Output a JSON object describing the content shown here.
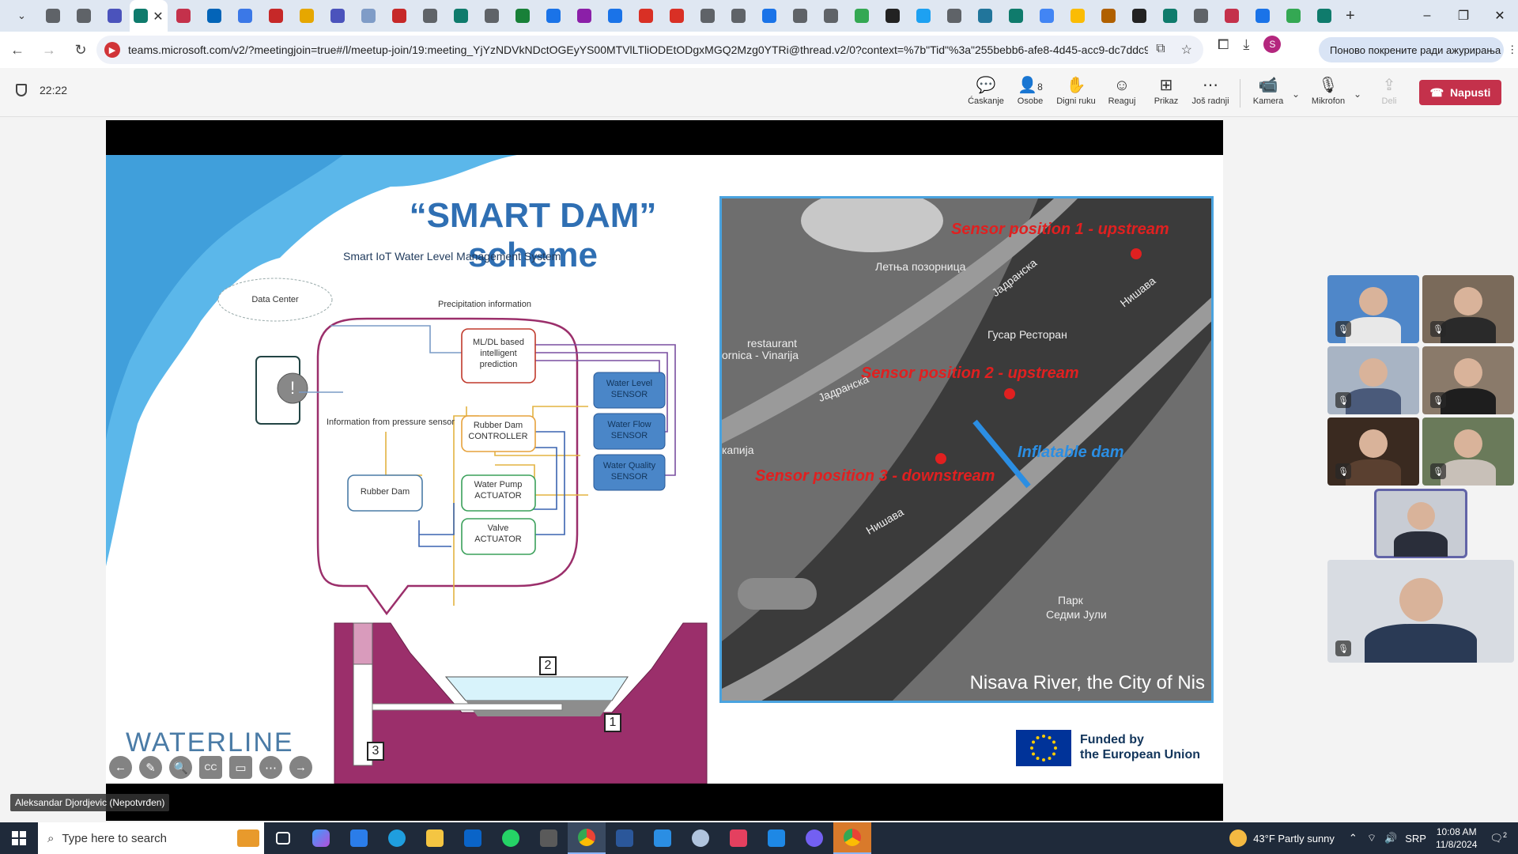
{
  "browser": {
    "tabs": [
      {
        "icon": "chrome-icon",
        "color": "#5f6368"
      },
      {
        "icon": "home-icon",
        "color": "#5f6368"
      },
      {
        "icon": "teams-icon",
        "color": "#4b53bc"
      },
      {
        "icon": "sway-icon",
        "color": "#0f7b6c"
      },
      {
        "icon": "pin-icon",
        "color": "#c4314b"
      },
      {
        "icon": "onedrive-icon",
        "color": "#0364b8"
      },
      {
        "icon": "globe-icon",
        "color": "#3b78e7"
      },
      {
        "icon": "pdf-icon",
        "color": "#c62828"
      },
      {
        "icon": "c-icon",
        "color": "#e6a700"
      },
      {
        "icon": "globe-icon",
        "color": "#4b53bc"
      },
      {
        "icon": "image-icon",
        "color": "#7f9cc7"
      },
      {
        "icon": "pdf-icon",
        "color": "#c62828"
      },
      {
        "icon": "link-icon",
        "color": "#5f6368"
      },
      {
        "icon": "sway-icon",
        "color": "#0f7b6c"
      },
      {
        "icon": "link-icon",
        "color": "#5f6368"
      },
      {
        "icon": "globe-icon",
        "color": "#188038"
      },
      {
        "icon": "globe-icon",
        "color": "#1a73e8"
      },
      {
        "icon": "mail-icon",
        "color": "#8b1fa8"
      },
      {
        "icon": "globe-icon",
        "color": "#1a73e8"
      },
      {
        "icon": "gmail-icon",
        "color": "#d93025"
      },
      {
        "icon": "gmail-icon",
        "color": "#d93025"
      },
      {
        "icon": "link-icon",
        "color": "#5f6368"
      },
      {
        "icon": "link-icon",
        "color": "#5f6368"
      },
      {
        "icon": "translate-icon",
        "color": "#1a73e8"
      },
      {
        "icon": "link-icon",
        "color": "#5f6368"
      },
      {
        "icon": "link-icon",
        "color": "#5f6368"
      },
      {
        "icon": "maps-icon",
        "color": "#34a853"
      },
      {
        "icon": "info-icon",
        "color": "#222222"
      },
      {
        "icon": "twitter-icon",
        "color": "#1da1f2"
      },
      {
        "icon": "globe-icon",
        "color": "#5f6368"
      },
      {
        "icon": "wordpress-icon",
        "color": "#21759b"
      },
      {
        "icon": "globe-icon",
        "color": "#0f7b6c"
      },
      {
        "icon": "google-icon",
        "color": "#4285f4"
      },
      {
        "icon": "drive-icon",
        "color": "#fbbc04"
      },
      {
        "icon": "globe-icon",
        "color": "#b06000"
      },
      {
        "icon": "info-icon",
        "color": "#222222"
      },
      {
        "icon": "sway-icon",
        "color": "#0f7b6c"
      },
      {
        "icon": "link-icon",
        "color": "#5f6368"
      },
      {
        "icon": "globe-icon",
        "color": "#c4314b"
      },
      {
        "icon": "globe-icon",
        "color": "#1a73e8"
      },
      {
        "icon": "sheets-icon",
        "color": "#34a853"
      },
      {
        "icon": "sway-icon",
        "color": "#0f7b6c"
      }
    ],
    "active_tab_close": "✕",
    "new_tab": "+",
    "url": "teams.microsoft.com/v2/?meetingjoin=true#/l/meetup-join/19:meeting_YjYzNDVkNDctOGEyYS00MTVlLTliODEtODgxMGQ2Mzg0YTRi@thread.v2/0?context=%7b\"Tid\"%3a\"255bebb6-afe8-4d45-acc9-dc7ddc94...",
    "profile_initial": "S",
    "update_label": "Поново покрените ради ажурирања",
    "window_controls": {
      "minimize": "–",
      "restore": "❐",
      "close": "✕"
    }
  },
  "teams": {
    "meeting_timer": "22:22",
    "toolbar": {
      "chat": {
        "label": "Ćaskanje",
        "icon": "chat-icon"
      },
      "people": {
        "label": "Osobe",
        "count": "8",
        "icon": "people-icon"
      },
      "raise_hand": {
        "label": "Digni ruku",
        "icon": "hand-icon"
      },
      "react": {
        "label": "Reaguj",
        "icon": "smiley-icon"
      },
      "view": {
        "label": "Prikaz",
        "icon": "grid-icon"
      },
      "more": {
        "label": "Još radnji",
        "icon": "more-icon"
      },
      "camera": {
        "label": "Kamera",
        "icon": "camera-icon"
      },
      "mic": {
        "label": "Mikrofon",
        "icon": "mic-off-icon"
      },
      "share": {
        "label": "Deli",
        "icon": "share-icon"
      },
      "leave": {
        "label": "Napusti",
        "icon": "phone-hangup-icon"
      }
    },
    "presenter_name": "Aleksandar Djordjevic (Nepotvrđen)",
    "participants": [
      {
        "shirt": "#e8e8e8",
        "bg": "#4f87c9",
        "muted": true
      },
      {
        "shirt": "#2a2a2a",
        "bg": "#7a6a5a",
        "muted": true
      },
      {
        "shirt": "#4a5a7a",
        "bg": "#a8b4c4",
        "muted": true
      },
      {
        "shirt": "#1e1e1e",
        "bg": "#8a7a6a",
        "muted": true
      },
      {
        "shirt": "#5a4030",
        "bg": "#3a2a20",
        "muted": true
      },
      {
        "shirt": "#c8c0b8",
        "bg": "#6a7a5a",
        "muted": true
      },
      {
        "shirt": "#2a2e3a",
        "bg": "#c8ccd4",
        "muted": false,
        "speaking": true
      },
      {
        "shirt": "#2a3a55",
        "bg": "#d8dce2",
        "muted": true
      }
    ]
  },
  "slide": {
    "title": "“SMART DAM” scheme",
    "subtitle": "Smart IoT Water Level Management System",
    "labels": {
      "data_center": "Data Center",
      "precipitation": "Precipitation information",
      "ml_prediction": "ML/DL based intelligent prediction",
      "pressure_info": "Information from pressure sensor",
      "rubber_dam_controller": "Rubber Dam CONTROLLER",
      "rubber_dam": "Rubber Dam",
      "water_pump": "Water Pump ACTUATOR",
      "valve": "Valve ACTUATOR",
      "water_level_sensor": "Water Level SENSOR",
      "water_flow_sensor": "Water Flow SENSOR",
      "water_quality_sensor": "Water Quality SENSOR",
      "num_1": "1",
      "num_2": "2",
      "num_3": "3"
    },
    "map": {
      "sensor_1": "Sensor position 1 - upstream",
      "sensor_2": "Sensor position 2 - upstream",
      "sensor_3": "Sensor position 3 - downstream",
      "inflatable_dam": "Inflatable dam",
      "caption": "Nisava River, the City of Nis",
      "streets": [
        "Летња позорница",
        "Јадранска",
        "Нишава",
        "Гусар Ресторан",
        "restaurant",
        "ornica - Vinarija",
        "Јадранска",
        "капија",
        "Нишава",
        "Парк",
        "Седми Јули"
      ]
    },
    "logo": "WATERLINE",
    "funding_line1": "Funded by",
    "funding_line2": "the European Union",
    "controls": [
      "←",
      "✎",
      "🔍",
      "CC",
      "▭",
      "⋯",
      "→"
    ]
  },
  "taskbar": {
    "search_placeholder": "Type here to search",
    "weather": "43°F  Partly sunny",
    "language": "SRP",
    "time": "10:08 AM",
    "date": "11/8/2024",
    "notification_count": "2"
  },
  "colors": {
    "accent_teams": "#6264a7",
    "leave_red": "#c4314b",
    "slide_title_blue": "#2f6fb3",
    "sensor_red": "#e02020",
    "dam_blue": "#2b8ee3",
    "dam_magenta": "#9b2f6b"
  }
}
